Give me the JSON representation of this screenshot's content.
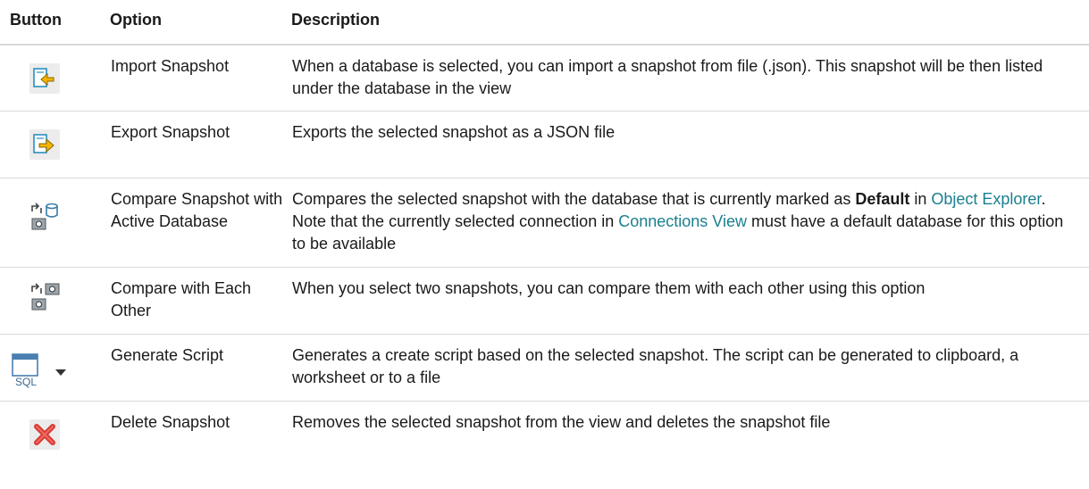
{
  "table": {
    "headers": {
      "button": "Button",
      "option": "Option",
      "description": "Description"
    },
    "rows": [
      {
        "icon": "import-snapshot-icon",
        "option": "Import Snapshot",
        "description": "When a database is selected, you can import a snapshot from file (.json). This snapshot will be then listed under the database in the view"
      },
      {
        "icon": "export-snapshot-icon",
        "option": "Export Snapshot",
        "description": "Exports the selected snapshot as a JSON file"
      },
      {
        "icon": "compare-snapshot-database-icon",
        "option": "Compare Snapshot with Active Database",
        "description_parts": {
          "p1": "Compares the selected snapshot with the database that is currently marked as ",
          "bold": "Default",
          "p2": " in ",
          "link1": "Object Explorer",
          "p3": ". Note that the currently selected connection in ",
          "link2": "Connections View",
          "p4": " must have a default database for this option to be available"
        }
      },
      {
        "icon": "compare-snapshots-icon",
        "option": "Compare with Each Other",
        "description": "When you select two snapshots, you can compare them with each other using this option"
      },
      {
        "icon": "generate-sql-script-icon",
        "option": "Generate Script",
        "description": "Generates a create script based on the selected snapshot. The script can be generated to clipboard, a worksheet or to a file"
      },
      {
        "icon": "delete-icon",
        "option": "Delete Snapshot",
        "description": "Removes the selected snapshot from the view and deletes the snapshot file"
      }
    ],
    "icon_text": {
      "sql": "SQL"
    }
  }
}
